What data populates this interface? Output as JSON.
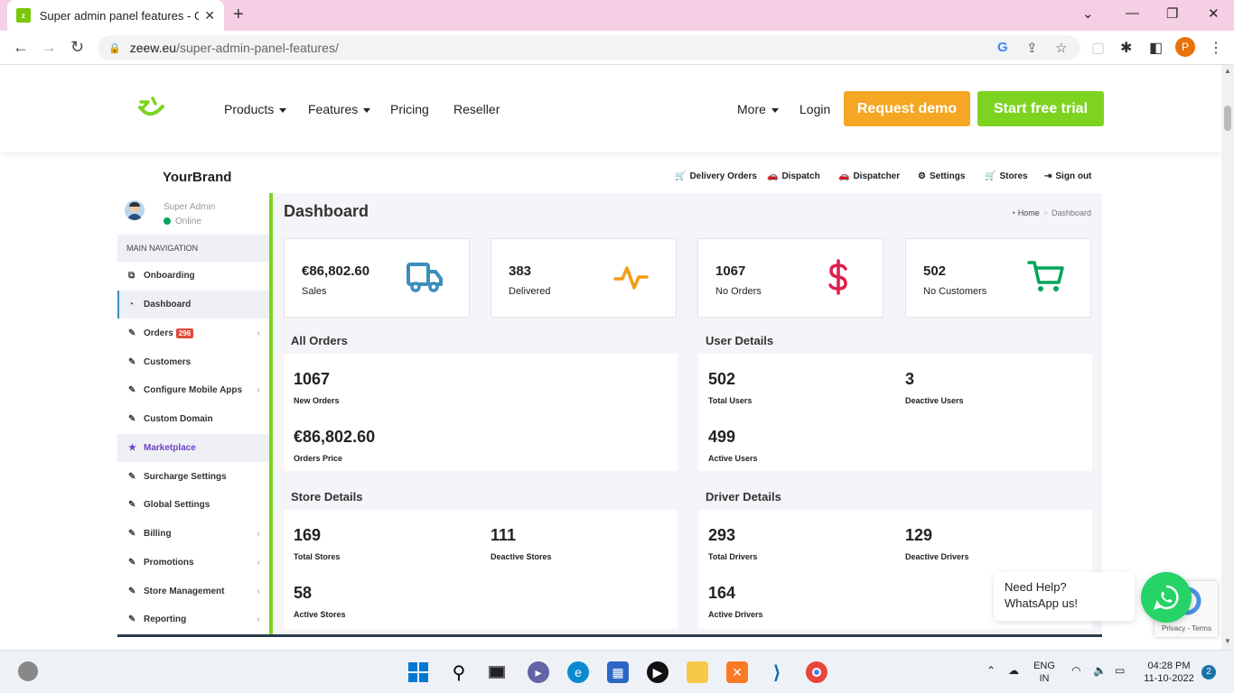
{
  "browser": {
    "tab_title": "Super admin panel features - Gro",
    "url_domain": "zeew.eu",
    "url_path": "/super-admin-panel-features/",
    "profile_initial": "P"
  },
  "site_nav": {
    "products": "Products",
    "features": "Features",
    "pricing": "Pricing",
    "reseller": "Reseller",
    "more": "More",
    "login": "Login",
    "request_demo": "Request demo",
    "start_trial": "Start free trial"
  },
  "panel": {
    "brand": "YourBrand",
    "topnav": [
      "Delivery Orders",
      "Dispatch",
      "Dispatcher",
      "Settings",
      "Stores",
      "Sign out"
    ],
    "user_name": "Super Admin",
    "user_status": "Online",
    "main_nav_label": "MAIN NAVIGATION",
    "sidebar": [
      {
        "label": "Onboarding"
      },
      {
        "label": "Dashboard"
      },
      {
        "label": "Orders",
        "badge": "296"
      },
      {
        "label": "Customers"
      },
      {
        "label": "Configure Mobile Apps"
      },
      {
        "label": "Custom Domain"
      },
      {
        "label": "Marketplace"
      },
      {
        "label": "Surcharge Settings"
      },
      {
        "label": "Global Settings"
      },
      {
        "label": "Billing"
      },
      {
        "label": "Promotions"
      },
      {
        "label": "Store Management"
      },
      {
        "label": "Reporting"
      }
    ],
    "title": "Dashboard",
    "breadcrumb_home": "Home",
    "breadcrumb_current": "Dashboard",
    "stats": [
      {
        "value": "€86,802.60",
        "label": "Sales",
        "icon": "truck-icon",
        "color": "#3c8dbc"
      },
      {
        "value": "383",
        "label": "Delivered",
        "icon": "activity-icon",
        "color": "#f39c12"
      },
      {
        "value": "1067",
        "label": "No Orders",
        "icon": "dollar-icon",
        "color": "#dd1f4b"
      },
      {
        "value": "502",
        "label": "No Customers",
        "icon": "cart-icon",
        "color": "#00a65a"
      }
    ],
    "all_orders": {
      "title": "All Orders",
      "new_orders_value": "1067",
      "new_orders_label": "New Orders",
      "orders_price_value": "€86,802.60",
      "orders_price_label": "Orders Price"
    },
    "user_details": {
      "title": "User Details",
      "total_value": "502",
      "total_label": "Total Users",
      "deactive_value": "3",
      "deactive_label": "Deactive Users",
      "active_value": "499",
      "active_label": "Active Users"
    },
    "store_details": {
      "title": "Store Details",
      "total_value": "169",
      "total_label": "Total Stores",
      "deactive_value": "111",
      "deactive_label": "Deactive Stores",
      "active_value": "58",
      "active_label": "Active Stores"
    },
    "driver_details": {
      "title": "Driver Details",
      "total_value": "293",
      "total_label": "Total Drivers",
      "deactive_value": "129",
      "deactive_label": "Deactive Drivers",
      "active_value": "164",
      "active_label": "Active Drivers"
    }
  },
  "whatsapp": {
    "help_text": "Need Help? WhatsApp us!"
  },
  "recaptcha": {
    "terms": "Privacy - Terms"
  },
  "taskbar": {
    "lang_top": "ENG",
    "lang_bottom": "IN",
    "time": "04:28 PM",
    "date": "11-10-2022",
    "notifications": "2"
  },
  "colors": {
    "brand_green": "#7ed321",
    "demo_orange": "#f5a623",
    "tab_bar": "#f5cfe3"
  }
}
